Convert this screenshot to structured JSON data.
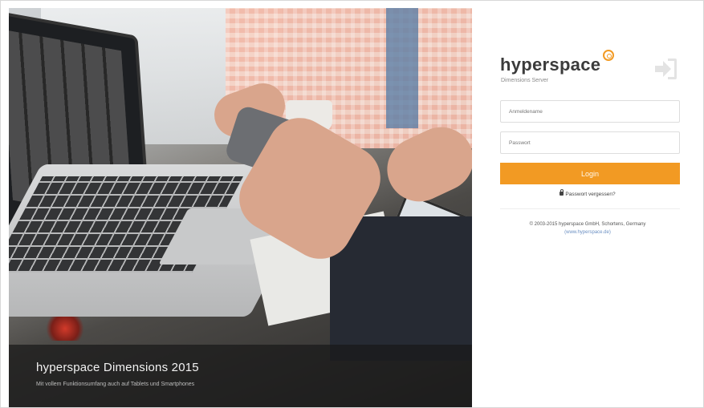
{
  "hero": {
    "title": "hyperspace Dimensions 2015",
    "subtitle": "Mit vollem Funktionsumfang auch auf Tablets und Smartphones"
  },
  "brand": {
    "name": "hyperspace",
    "tagline": "Dimensions Server",
    "accent_color": "#f29a23",
    "mark_icon": "hyperspace-logo-mark"
  },
  "login": {
    "username_placeholder": "Anmeldename",
    "password_placeholder": "Passwort",
    "button_label": "Login",
    "forgot_label": "Passwort vergessen?",
    "enter_icon": "sign-in-icon",
    "lock_icon": "lock-icon"
  },
  "footer": {
    "copyright": "© 2003-2015 hyperspace GmbH, Schortens, Germany",
    "link_label": "(www.hyperspace.de)"
  }
}
